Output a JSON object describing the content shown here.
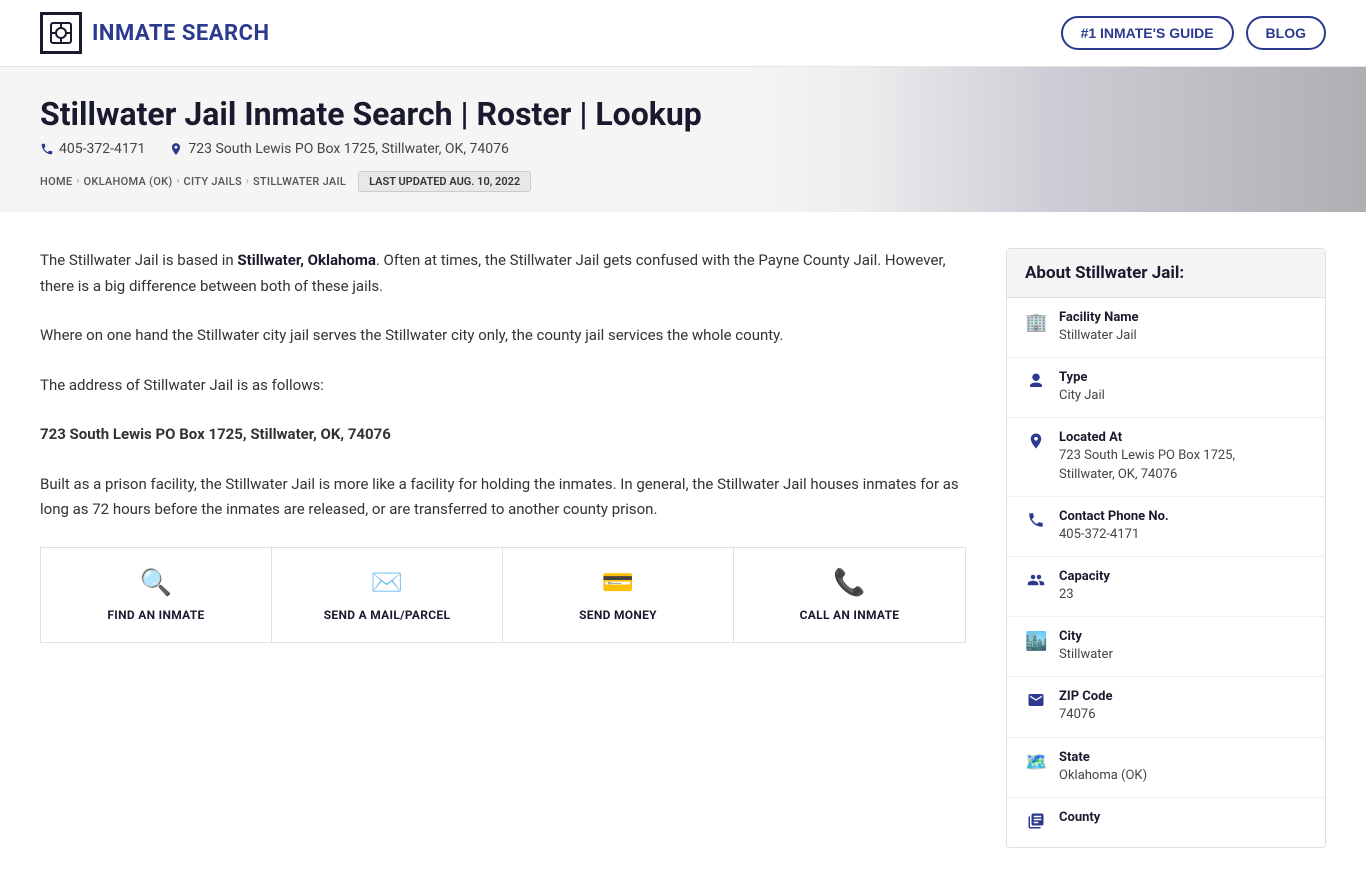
{
  "header": {
    "logo_text": "INMATE SEARCH",
    "nav": {
      "guide_label": "#1 INMATE'S GUIDE",
      "blog_label": "BLOG"
    }
  },
  "hero": {
    "title": "Stillwater Jail Inmate Search | Roster | Lookup",
    "phone": "405-372-4171",
    "address": "723 South Lewis PO Box 1725, Stillwater, OK, 74076",
    "breadcrumbs": [
      {
        "label": "HOME"
      },
      {
        "label": "OKLAHOMA (OK)"
      },
      {
        "label": "CITY JAILS"
      },
      {
        "label": "STILLWATER JAIL"
      }
    ],
    "last_updated_badge": "LAST UPDATED AUG. 10, 2022"
  },
  "article": {
    "para1": "The Stillwater Jail is based in ",
    "para1_bold": "Stillwater, Oklahoma",
    "para1_rest": ". Often at times, the Stillwater Jail gets confused with the Payne County Jail. However, there is a big difference between both of these jails.",
    "para2": "Where on one hand the Stillwater city jail serves the Stillwater city only, the county jail services the whole county.",
    "para3": "The address of Stillwater Jail is as follows:",
    "bold_address": "723 South Lewis PO Box 1725, Stillwater, OK, 74076",
    "para4": "Built as a prison facility, the Stillwater Jail is more like a facility for holding the inmates. In general, the Stillwater Jail houses inmates for as long as 72 hours before the inmates are released, or are transferred to another county prison.",
    "actions": [
      {
        "label": "FIND AN INMATE",
        "icon": "🔍"
      },
      {
        "label": "SEND A MAIL/PARCEL",
        "icon": "✉️"
      },
      {
        "label": "SEND MONEY",
        "icon": "💳"
      },
      {
        "label": "CALL AN INMATE",
        "icon": "📞"
      }
    ]
  },
  "sidebar": {
    "title": "About Stillwater Jail:",
    "rows": [
      {
        "label": "Facility Name",
        "value": "Stillwater Jail",
        "icon": "🏢"
      },
      {
        "label": "Type",
        "value": "City Jail",
        "icon": "👤"
      },
      {
        "label": "Located At",
        "value": "723 South Lewis PO Box 1725, Stillwater, OK, 74076",
        "icon": "📍"
      },
      {
        "label": "Contact Phone No.",
        "value": "405-372-4171",
        "icon": "📞"
      },
      {
        "label": "Capacity",
        "value": "23",
        "icon": "👥"
      },
      {
        "label": "City",
        "value": "Stillwater",
        "icon": "🏙️"
      },
      {
        "label": "ZIP Code",
        "value": "74076",
        "icon": "✉️"
      },
      {
        "label": "State",
        "value": "Oklahoma (OK)",
        "icon": "🗺️"
      },
      {
        "label": "County",
        "value": "",
        "icon": "📋"
      }
    ]
  }
}
